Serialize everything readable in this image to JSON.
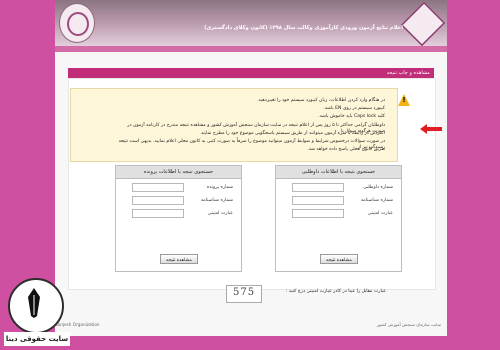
{
  "header": {
    "title": "اعلام نتایج آزمون ورودی کارآموزی وکالت سال ۱۳۹۸ (کانون وکلای دادگستری)"
  },
  "section": {
    "title": "مشاهده و چاپ نتیجه"
  },
  "notice": {
    "lines": [
      "در هنگام وارد کردن اطلاعات، زبان کیبورد سیستم خود را تغییردهید.",
      "کیبورد سیستم در روی EN باشد.",
      "کلید Caps lock باید خاموش باشد.",
      "داوطلبان گرامی حداکثر تا ۵ روز پس از اعلام نتیجه در سایت سازمان سنجش آموزش کشور و مشاهده نتیجه مندرج در کارنامه آزمون در صورت هرگونه سوال یا",
      "اعتراض در رابطه با نمره آزمون میتوانند از طریق سیستم پاسخگویی موضوع خود را مطرح نمایند",
      "در صورت سوالات درخصوص شرایط و ضوابط آزمون میتوانید موضوع را صرفاً به صورت کتبی به کانون محلی اعلام نمایید. بدیهی است نتیجه رسیدگی نیز از",
      "طریق کانون محلی پاسخ داده خواهد شد."
    ]
  },
  "panels": {
    "right": {
      "title": "جستجوی نتیجه با اطلاعات داوطلبی",
      "fields": [
        "شماره داوطلبی",
        "شماره شناسنامه",
        "عبارت امنیتی"
      ],
      "button": "مشاهده نتیجه"
    },
    "left": {
      "title": "جستجوی نتیجه با اطلاعات پرونده",
      "fields": [
        "شماره پرونده",
        "شماره شناسنامه",
        "عبارت امنیتی"
      ],
      "button": "مشاهده نتیجه"
    }
  },
  "captcha": {
    "value": "575",
    "label": "عبارت مقابل را عینا در کادر عبارت امنیتی درج کنید :"
  },
  "footer": {
    "left": "Sanjesh Organization",
    "right": "سایت سازمان سنجش آموزش کشور"
  },
  "brand": {
    "text": "سایت حقوقی دینا"
  },
  "colors": {
    "background": "#cf4fa0",
    "section_bar": "#c12d78",
    "notice_bg": "#fdf6d8",
    "arrow": "#e11d22"
  },
  "icons": {
    "warning": "warning-triangle-icon",
    "arrow": "red-arrow-icon",
    "emblem_left": "organization-emblem-icon",
    "emblem_right": "institution-emblem-icon",
    "brand": "pen-logo-icon"
  }
}
